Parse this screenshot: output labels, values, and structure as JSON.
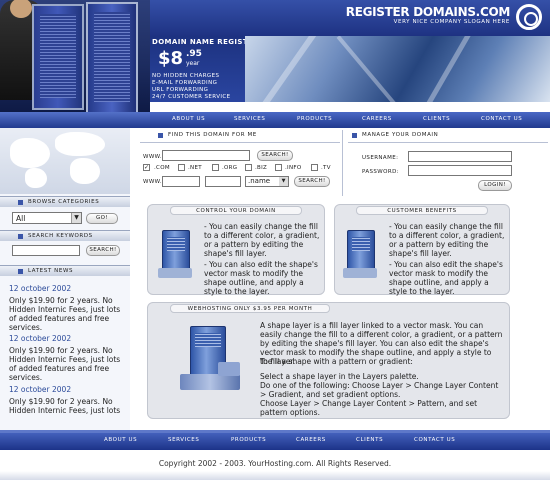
{
  "header": {
    "brand": "REGISTER DOMAINS.COM",
    "slogan": "VERY NICE COMPANY SLOGAN HERE",
    "promo_title": "DOMAIN NAME REGISTRATION",
    "price_dollar": "$8",
    "price_cents": ".95",
    "price_period": "year",
    "features": [
      "NO HIDDEN CHARGES",
      "E-MAIL FORWARDING",
      "URL FORWARDING",
      "24/7 CUSTOMER SERVICE"
    ]
  },
  "nav": {
    "items": [
      "ABOUT US",
      "SERVICES",
      "PRODUCTS",
      "CAREERS",
      "CLIENTS",
      "CONTACT US"
    ]
  },
  "sidebar": {
    "browse_heading": "BROWSE CATEGORIES",
    "category_value": "All",
    "go_label": "GO!",
    "keywords_heading": "SEARCH KEYWORDS",
    "search_label": "SEARCH!",
    "news_heading": "LATEST NEWS",
    "news": [
      {
        "date": "12 october 2002",
        "text": "Only $19.90 for 2 years. No Hidden Internic Fees, just lots of added features and free services."
      },
      {
        "date": "12 october 2002",
        "text": "Only $19.90 for 2 years. No Hidden Internic Fees, just lots of added features and free services."
      },
      {
        "date": "12 october 2002",
        "text": "Only $19.90 for 2 years. No Hidden Internic Fees, just lots"
      }
    ]
  },
  "find_domain": {
    "heading": "FIND THIS DOMAIN FOR ME",
    "www_label": "WWW.",
    "search_label": "SEARCH!",
    "tlds": [
      ".COM",
      ".NET",
      ".ORG",
      ".BIZ",
      ".INFO",
      ".TV"
    ],
    "com_checked_mark": "✓",
    "www_label2": "WWW.",
    "name_select": ".name",
    "search_label2": "SEARCH!"
  },
  "manage_domain": {
    "heading": "MANAGE YOUR DOMAIN",
    "username_label": "USERNAME:",
    "password_label": "PASSWORD:",
    "login_label": "LOGIN!"
  },
  "boxes": {
    "control_heading": "CONTROL YOUR DOMAIN",
    "control_p1": "- You can easily change the fill to a different color, a gradient, or a pattern by editing the shape's fill layer.",
    "control_p2": "- You can also edit the shape's vector mask to modify the shape outline, and apply a style to the layer.",
    "benefits_heading": "CUSTOMER BENEFITS",
    "benefits_p1": "- You can easily change the fill to a different color, a gradient, or a pattern by editing the shape's fill layer.",
    "benefits_p2": "- You can also edit the shape's vector mask to modify the shape outline, and apply a style to the layer.",
    "hosting_heading": "WEBHOSTING ONLY $3.95 PER MONTH",
    "hosting_p1": "A shape layer is a fill layer linked to a vector mask. You can easily change the fill to a different color, a gradient, or a pattern by editing the shape's fill layer. You can also edit the shape's vector mask to modify the shape outline, and apply a style to the layer.",
    "hosting_p2": "To fill a shape with a pattern or gradient:",
    "hosting_p3": "Select a shape layer in the Layers palette.",
    "hosting_p4": "Do one of the following: Choose Layer > Change Layer Content > Gradient, and set gradient options.",
    "hosting_p5": "Choose Layer > Change Layer Content > Pattern, and set pattern options."
  },
  "footer": {
    "nav": [
      "ABOUT US",
      "SERVICES",
      "PRODUCTS",
      "CAREERS",
      "CLIENTS",
      "CONTACT US"
    ],
    "copyright": "Copyright 2002 - 2003.  YourHosting.com.  All Rights Reserved."
  }
}
